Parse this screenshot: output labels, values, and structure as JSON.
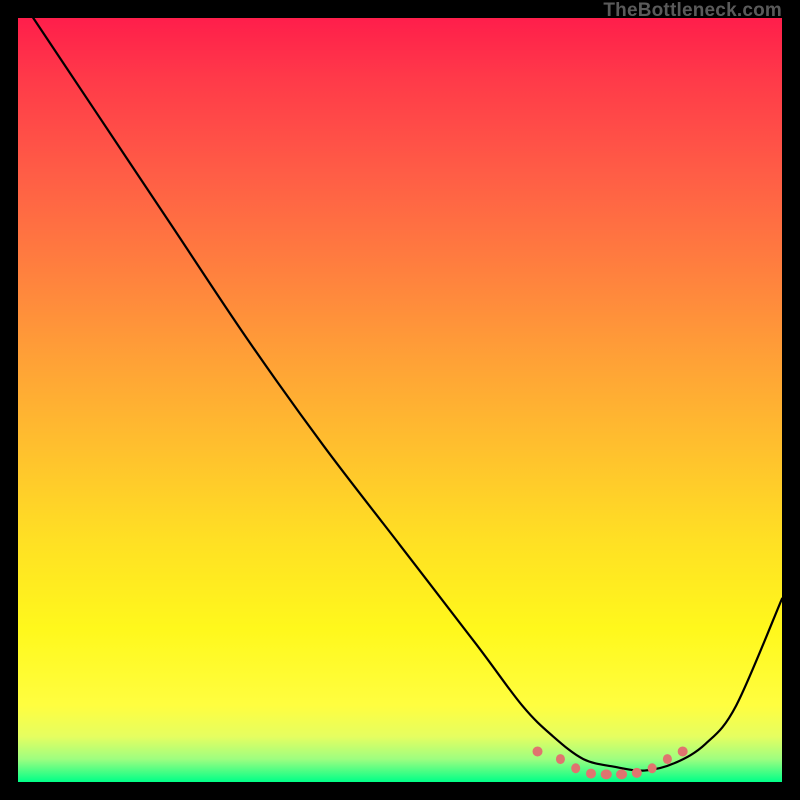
{
  "attribution": "TheBottleneck.com",
  "chart_data": {
    "type": "line",
    "title": "",
    "xlabel": "",
    "ylabel": "",
    "xlim": [
      0,
      100
    ],
    "ylim": [
      0,
      100
    ],
    "series": [
      {
        "name": "bottleneck-curve",
        "x": [
          0,
          10,
          20,
          30,
          40,
          50,
          60,
          66,
          70,
          74,
          78,
          82,
          86,
          90,
          94,
          100
        ],
        "values": [
          103,
          88,
          73,
          58,
          44,
          31,
          18,
          10,
          6,
          3,
          2,
          1.5,
          2.5,
          5,
          10,
          24
        ]
      }
    ],
    "markers": {
      "name": "minimum-region-dots",
      "color": "#e0746f",
      "x": [
        68,
        71,
        73,
        75,
        77,
        79,
        81,
        83,
        85,
        87
      ],
      "values": [
        4,
        3,
        1.8,
        1.1,
        1,
        1,
        1.2,
        1.8,
        3,
        4
      ]
    },
    "gradient_stops": [
      {
        "pos": 0,
        "color": "#ff1e4b"
      },
      {
        "pos": 8,
        "color": "#ff3a49"
      },
      {
        "pos": 20,
        "color": "#ff5c46"
      },
      {
        "pos": 32,
        "color": "#ff7d3f"
      },
      {
        "pos": 44,
        "color": "#ff9f37"
      },
      {
        "pos": 56,
        "color": "#ffbf2e"
      },
      {
        "pos": 68,
        "color": "#ffdf24"
      },
      {
        "pos": 80,
        "color": "#fff81c"
      },
      {
        "pos": 90,
        "color": "#fffe40"
      },
      {
        "pos": 94,
        "color": "#e6fe60"
      },
      {
        "pos": 97,
        "color": "#9efe80"
      },
      {
        "pos": 100,
        "color": "#00ff88"
      }
    ]
  }
}
